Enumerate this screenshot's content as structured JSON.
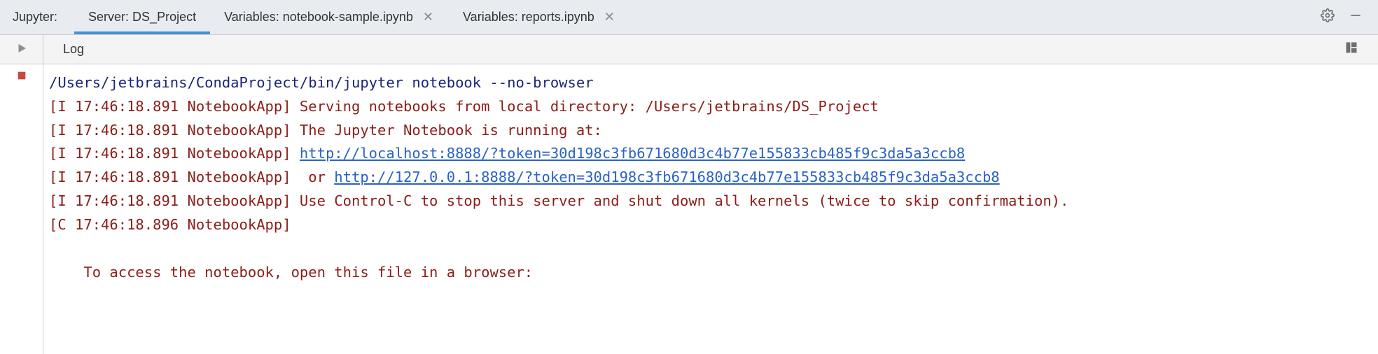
{
  "top": {
    "label": "Jupyter:",
    "tabs": [
      {
        "label": "Server: DS_Project",
        "active": true,
        "closable": false
      },
      {
        "label": "Variables: notebook-sample.ipynb",
        "active": false,
        "closable": true
      },
      {
        "label": "Variables: reports.ipynb",
        "active": false,
        "closable": true
      }
    ]
  },
  "subbar": {
    "label": "Log"
  },
  "console": {
    "command": "/Users/jetbrains/CondaProject/bin/jupyter notebook --no-browser",
    "lines": [
      {
        "prefix": "[I 17:46:18.891 NotebookApp] ",
        "text": "Serving notebooks from local directory: /Users/jetbrains/DS_Project"
      },
      {
        "prefix": "[I 17:46:18.891 NotebookApp] ",
        "text": "The Jupyter Notebook is running at:"
      },
      {
        "prefix": "[I 17:46:18.891 NotebookApp] ",
        "link": "http://localhost:8888/?token=30d198c3fb671680d3c4b77e155833cb485f9c3da5a3ccb8"
      },
      {
        "prefix": "[I 17:46:18.891 NotebookApp]  ",
        "pretext": "or ",
        "link": "http://127.0.0.1:8888/?token=30d198c3fb671680d3c4b77e155833cb485f9c3da5a3ccb8"
      },
      {
        "prefix": "[I 17:46:18.891 NotebookApp] ",
        "text": "Use Control-C to stop this server and shut down all kernels (twice to skip confirmation)."
      },
      {
        "prefix": "[C 17:46:18.896 NotebookApp]"
      },
      {
        "prefix": ""
      },
      {
        "prefix": "    To access the notebook, open this file in a browser:"
      }
    ]
  }
}
